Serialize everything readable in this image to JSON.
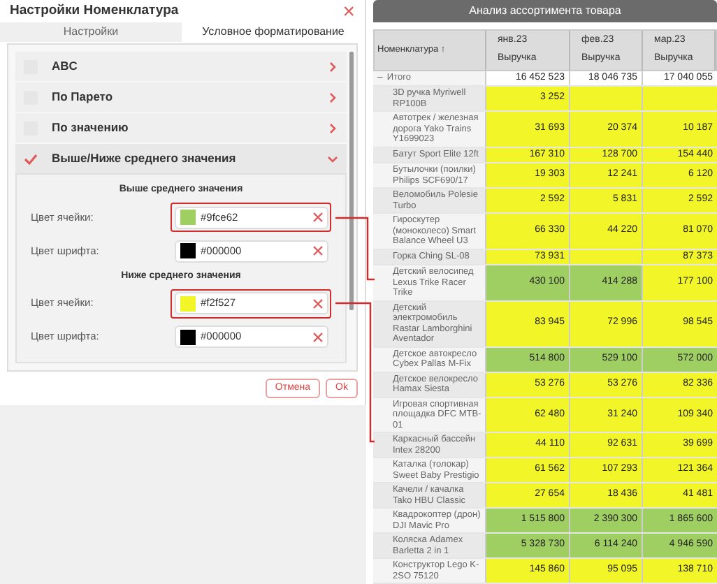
{
  "dialog": {
    "title": "Настройки Номенклатура",
    "close": "×",
    "tabs": [
      {
        "label": "Настройки",
        "selected": false
      },
      {
        "label": "Условное форматирование",
        "selected": true
      }
    ],
    "rules": [
      {
        "label": "ABC",
        "checked": false,
        "expanded": false
      },
      {
        "label": "По Парето",
        "checked": false,
        "expanded": false
      },
      {
        "label": "По значению",
        "checked": false,
        "expanded": false
      },
      {
        "label": "Выше/Ниже среднего значения",
        "checked": true,
        "expanded": true
      }
    ],
    "groups": [
      {
        "heading": "Выше среднего значения",
        "fields": [
          {
            "label": "Цвет ячейки:",
            "color": "#9fce62",
            "value": "#9fce62",
            "highlighted": true
          },
          {
            "label": "Цвет шрифта:",
            "color": "#000000",
            "value": "#000000",
            "highlighted": false
          }
        ]
      },
      {
        "heading": "Ниже среднего значения",
        "fields": [
          {
            "label": "Цвет ячейки:",
            "color": "#f2f527",
            "value": "#f2f527",
            "highlighted": true
          },
          {
            "label": "Цвет шрифта:",
            "color": "#000000",
            "value": "#000000",
            "highlighted": false
          }
        ]
      }
    ],
    "buttons": [
      "Отмена",
      "Ok"
    ]
  },
  "report": {
    "title": "Анализ ассортимента товара",
    "name_header": "Номенклатура ↑",
    "columns": [
      {
        "period": "янв.23",
        "measure": "Выручка"
      },
      {
        "period": "фев.23",
        "measure": "Выручка"
      },
      {
        "period": "мар.23",
        "measure": "Выручка"
      }
    ],
    "rows": [
      {
        "toggle": "–",
        "name": "Итого",
        "cells": [
          {
            "text": "16 452 523"
          },
          {
            "text": "18 046 735"
          },
          {
            "text": "17 040 055"
          }
        ]
      },
      {
        "name": "3D ручка Myriwell RP100B",
        "cells": [
          {
            "text": "3 252",
            "color": "#f2f527"
          },
          {
            "color": "#f2f527"
          },
          {
            "color": "#f2f527"
          }
        ]
      },
      {
        "name": "Автотрек / железная дорога Yako Trains Y1699023",
        "cells": [
          {
            "text": "31 693",
            "color": "#f2f527"
          },
          {
            "text": "20 374",
            "color": "#f2f527"
          },
          {
            "text": "10 187",
            "color": "#f2f527"
          }
        ]
      },
      {
        "name": "Батут Sport Elite 12ft",
        "cells": [
          {
            "text": "167 310",
            "color": "#f2f527"
          },
          {
            "text": "128 700",
            "color": "#f2f527"
          },
          {
            "text": "154 440",
            "color": "#f2f527"
          }
        ]
      },
      {
        "name": "Бутылочки (поилки) Philips SCF690/17",
        "cells": [
          {
            "text": "19 303",
            "color": "#f2f527"
          },
          {
            "text": "12 241",
            "color": "#f2f527"
          },
          {
            "text": "6 120",
            "color": "#f2f527"
          }
        ]
      },
      {
        "name": "Веломобиль Polesie Turbo",
        "cells": [
          {
            "text": "2 592",
            "color": "#f2f527"
          },
          {
            "text": "5 831",
            "color": "#f2f527"
          },
          {
            "text": "2 592",
            "color": "#f2f527"
          }
        ]
      },
      {
        "name": "Гироскутер (моноколесо) Smart Balance Wheel U3",
        "cells": [
          {
            "text": "66 330",
            "color": "#f2f527"
          },
          {
            "text": "44 220",
            "color": "#f2f527"
          },
          {
            "text": "81 070",
            "color": "#f2f527"
          }
        ]
      },
      {
        "name": "Горка Ching SL-08",
        "cells": [
          {
            "text": "73 931",
            "color": "#f2f527"
          },
          {
            "color": "#f2f527"
          },
          {
            "text": "87 373",
            "color": "#f2f527"
          }
        ]
      },
      {
        "name": "Детский велосипед Lexus Trike Racer Trike",
        "cells": [
          {
            "text": "430 100",
            "color": "#9fce62"
          },
          {
            "text": "414 288",
            "color": "#9fce62"
          },
          {
            "text": "177 100",
            "color": "#f2f527"
          }
        ]
      },
      {
        "name": "Детский электромобиль Rastar Lamborghini Aventador",
        "cells": [
          {
            "text": "83 945",
            "color": "#f2f527"
          },
          {
            "text": "72 996",
            "color": "#f2f527"
          },
          {
            "text": "98 545",
            "color": "#f2f527"
          }
        ]
      },
      {
        "name": "Детское автокресло Cybex Pallas M-Fix",
        "cells": [
          {
            "text": "514 800",
            "color": "#9fce62"
          },
          {
            "text": "529 100",
            "color": "#9fce62"
          },
          {
            "text": "572 000",
            "color": "#9fce62"
          }
        ]
      },
      {
        "name": "Детское велокресло Hamax Siesta",
        "cells": [
          {
            "text": "53 276",
            "color": "#f2f527"
          },
          {
            "text": "53 276",
            "color": "#f2f527"
          },
          {
            "text": "82 336",
            "color": "#f2f527"
          }
        ]
      },
      {
        "name": "Игровая спортивная площадка DFC MTB-01",
        "cells": [
          {
            "text": "62 480",
            "color": "#f2f527"
          },
          {
            "text": "31 240",
            "color": "#f2f527"
          },
          {
            "text": "109 340",
            "color": "#f2f527"
          }
        ]
      },
      {
        "name": "Каркасный бассейн Intex 28200",
        "cells": [
          {
            "text": "44 110",
            "color": "#f2f527"
          },
          {
            "text": "92 631",
            "color": "#f2f527"
          },
          {
            "text": "39 699",
            "color": "#f2f527"
          }
        ]
      },
      {
        "name": "Каталка (толокар) Sweet Baby Prestigio",
        "cells": [
          {
            "text": "61 562",
            "color": "#f2f527"
          },
          {
            "text": "107 293",
            "color": "#f2f527"
          },
          {
            "text": "121 364",
            "color": "#f2f527"
          }
        ]
      },
      {
        "name": "Качели / качалка Tako HBU Classic",
        "cells": [
          {
            "text": "27 654",
            "color": "#f2f527"
          },
          {
            "text": "18 436",
            "color": "#f2f527"
          },
          {
            "text": "41 481",
            "color": "#f2f527"
          }
        ]
      },
      {
        "name": "Квадрокоптер (дрон) DJI Mavic Pro",
        "cells": [
          {
            "text": "1 515 800",
            "color": "#9fce62"
          },
          {
            "text": "2 390 300",
            "color": "#9fce62"
          },
          {
            "text": "1 865 600",
            "color": "#9fce62"
          }
        ]
      },
      {
        "name": "Коляска Adamex Barletta 2 in 1",
        "cells": [
          {
            "text": "5 328 730",
            "color": "#9fce62"
          },
          {
            "text": "6 114 240",
            "color": "#9fce62"
          },
          {
            "text": "4 946 590",
            "color": "#9fce62"
          }
        ]
      },
      {
        "name": "Конструктор Lego K-2SO 75120",
        "cells": [
          {
            "text": "145 860",
            "color": "#f2f527"
          },
          {
            "text": "95 095",
            "color": "#f2f527"
          },
          {
            "text": "138 710",
            "color": "#f2f527"
          }
        ]
      }
    ]
  }
}
